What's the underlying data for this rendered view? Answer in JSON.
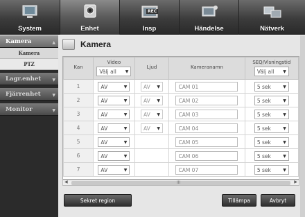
{
  "nav": {
    "tabs": [
      {
        "label": "System",
        "icon": "system-icon"
      },
      {
        "label": "Enhet",
        "icon": "device-icon"
      },
      {
        "label": "Insp",
        "icon": "record-icon"
      },
      {
        "label": "Händelse",
        "icon": "event-icon"
      },
      {
        "label": "Nätverk",
        "icon": "network-icon"
      }
    ],
    "active": 1,
    "rec_badge": "REC"
  },
  "sidebar": {
    "groups": [
      {
        "label": "Kamera",
        "open": true,
        "subitems": [
          "Kamera",
          "PTZ"
        ]
      },
      {
        "label": "Lagr.enhet",
        "open": false
      },
      {
        "label": "Fjärrenhet",
        "open": false
      },
      {
        "label": "Monitor",
        "open": false
      }
    ]
  },
  "panel": {
    "title": "Kamera",
    "columns": {
      "kan": "Kan",
      "video": "Video",
      "ljud": "Ljud",
      "namn": "Kameranamn",
      "seq": "SEQ/Visningstid"
    },
    "header_selects": {
      "video": "Välj all",
      "seq": "Välj all"
    },
    "rows": [
      {
        "kan": "1",
        "video": "AV",
        "ljud": "AV",
        "namn": "CAM 01",
        "seq": "5 sek"
      },
      {
        "kan": "2",
        "video": "AV",
        "ljud": "AV",
        "namn": "CAM 02",
        "seq": "5 sek"
      },
      {
        "kan": "3",
        "video": "AV",
        "ljud": "AV",
        "namn": "CAM 03",
        "seq": "5 sek"
      },
      {
        "kan": "4",
        "video": "AV",
        "ljud": "AV",
        "namn": "CAM 04",
        "seq": "5 sek"
      },
      {
        "kan": "5",
        "video": "AV",
        "ljud": "",
        "namn": "CAM 05",
        "seq": "5 sek"
      },
      {
        "kan": "6",
        "video": "AV",
        "ljud": "",
        "namn": "CAM 06",
        "seq": "5 sek"
      },
      {
        "kan": "7",
        "video": "AV",
        "ljud": "",
        "namn": "CAM 07",
        "seq": "5 sek"
      }
    ],
    "buttons": {
      "secret": "Sekret region",
      "apply": "Tillämpa",
      "cancel": "Avbryt"
    },
    "scroll_mark": "III"
  }
}
